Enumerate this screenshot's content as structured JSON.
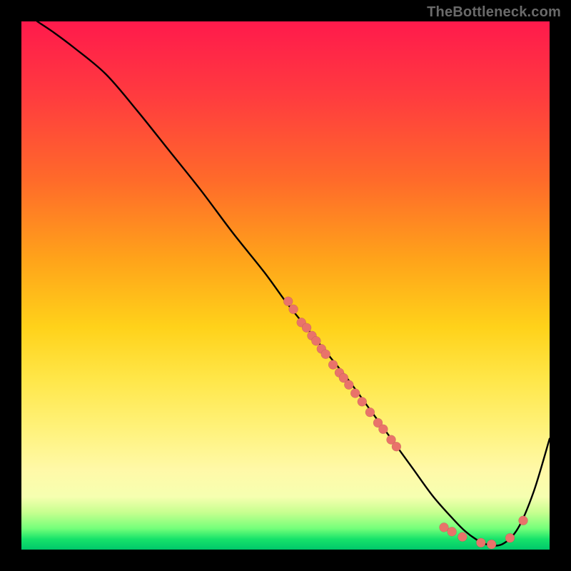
{
  "watermark": "TheBottleneck.com",
  "chart_data": {
    "type": "line",
    "title": "",
    "xlabel": "",
    "ylabel": "",
    "xlim": [
      0,
      100
    ],
    "ylim": [
      0,
      100
    ],
    "grid": false,
    "legend": false,
    "series": [
      {
        "name": "bottleneck-curve",
        "x": [
          3,
          6,
          10,
          16,
          22,
          28,
          34,
          40,
          46,
          50,
          54,
          58,
          62,
          66,
          70,
          74,
          78,
          82,
          84,
          86,
          88,
          91,
          94,
          97,
          100
        ],
        "y": [
          100,
          98,
          95,
          90,
          83,
          75.5,
          68,
          60,
          52.5,
          47,
          42,
          37,
          32,
          26.5,
          21,
          15.5,
          10,
          5.5,
          3.5,
          2,
          1,
          1,
          4,
          11,
          21
        ]
      }
    ],
    "scatter": [
      {
        "name": "highlight-points",
        "color": "#e9736a",
        "points": [
          {
            "x": 50.5,
            "y": 47
          },
          {
            "x": 51.5,
            "y": 45.5
          },
          {
            "x": 53,
            "y": 43
          },
          {
            "x": 54,
            "y": 42
          },
          {
            "x": 55,
            "y": 40.5
          },
          {
            "x": 55.8,
            "y": 39.5
          },
          {
            "x": 56.8,
            "y": 38
          },
          {
            "x": 57.6,
            "y": 37
          },
          {
            "x": 59,
            "y": 35
          },
          {
            "x": 60.2,
            "y": 33.5
          },
          {
            "x": 61,
            "y": 32.5
          },
          {
            "x": 62,
            "y": 31.2
          },
          {
            "x": 63.2,
            "y": 29.6
          },
          {
            "x": 64.5,
            "y": 28
          },
          {
            "x": 66,
            "y": 26
          },
          {
            "x": 67.5,
            "y": 24
          },
          {
            "x": 68.5,
            "y": 22.8
          },
          {
            "x": 70,
            "y": 20.8
          },
          {
            "x": 71,
            "y": 19.5
          },
          {
            "x": 80,
            "y": 4.2
          },
          {
            "x": 81.5,
            "y": 3.4
          },
          {
            "x": 83.5,
            "y": 2.4
          },
          {
            "x": 87,
            "y": 1.3
          },
          {
            "x": 89,
            "y": 1
          },
          {
            "x": 92.5,
            "y": 2.2
          },
          {
            "x": 95,
            "y": 5.5
          }
        ]
      }
    ]
  }
}
